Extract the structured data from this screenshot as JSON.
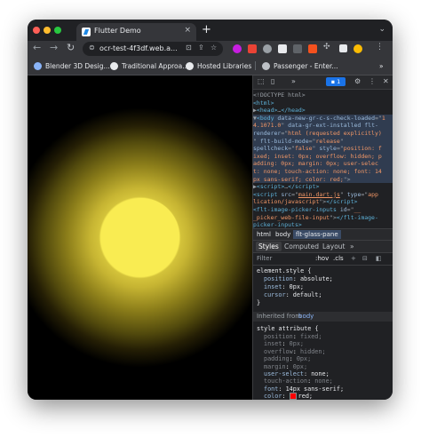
{
  "browser": {
    "tab_title": "Flutter Demo",
    "tab_close": "×",
    "new_tab": "+",
    "url": "ocr-test-4f3df.web.a...",
    "bookmarks": [
      {
        "label": "Blender 3D Desig...",
        "icon_color": "#8ab4f8"
      },
      {
        "label": "Traditional Approa...",
        "icon_color": "#e8eaed"
      },
      {
        "label": "Hosted Libraries",
        "icon_color": "#e8eaed"
      },
      {
        "label": "Passenger - Enter...",
        "icon_color": "#bdc1c6"
      }
    ],
    "bookmarks_more": "»"
  },
  "devtools": {
    "issues_count": "1",
    "elements_lines": [
      {
        "html": "<span class='punct'>&lt;!DOCTYPE html&gt;</span>"
      },
      {
        "html": "<span class='tag'>&lt;html&gt;</span>"
      },
      {
        "html": "<span class='punct'>▶</span><span class='tag'>&lt;head&gt;</span><span class='punct'>…</span><span class='tag'>&lt;/head&gt;</span>"
      },
      {
        "html": "<span class='punct'>▼</span><span class='tag'>&lt;body</span> <span class='attr'>data-new-gr-c-s-check-loaded</span><span class='punct'>=\"</span><span class='val'>1</span>",
        "sel": true
      },
      {
        "html": "<span class='val'>4.1071.0</span><span class='punct'>\"</span> <span class='attr'>data-gr-ext-installed</span> <span class='attr'>flt-</span>",
        "sel": true
      },
      {
        "html": "<span class='attr'>renderer</span><span class='punct'>=\"</span><span class='val'>html (requested explicitly)</span>",
        "sel": true
      },
      {
        "html": "<span class='punct'>\" </span><span class='attr'>flt-build-mode</span><span class='punct'>=\"</span><span class='val'>release</span><span class='punct'>\"</span>",
        "sel": true
      },
      {
        "html": "<span class='attr'>spellcheck</span><span class='punct'>=\"</span><span class='val'>false</span><span class='punct'>\" </span><span class='attr'>style</span><span class='punct'>=\"</span><span class='val'>position: f</span>",
        "sel": true
      },
      {
        "html": "<span class='val'>ixed; inset: 0px; overflow: hidden; p</span>",
        "sel": true
      },
      {
        "html": "<span class='val'>adding: 0px; margin: 0px; user-selec</span>",
        "sel": true
      },
      {
        "html": "<span class='val'>t: none; touch-action: none; font: 14</span>",
        "sel": true
      },
      {
        "html": "<span class='val'>px sans-serif; color: red;</span><span class='punct'>\"&gt;</span>",
        "sel": true
      },
      {
        "html": "<span class='punct'>  ▶</span><span class='tag'>&lt;script&gt;</span><span class='punct'>…</span><span class='tag'>&lt;/script&gt;</span>"
      },
      {
        "html": "<span class='tag'>    &lt;script</span> <span class='attr'>src</span><span class='punct'>=\"</span><span class='val' style='text-decoration:underline'>main.dart.js</span><span class='punct'>\" </span><span class='attr'>type</span><span class='punct'>=\"</span><span class='val'>app</span>"
      },
      {
        "html": "<span class='val'>    lication/javascript</span><span class='punct'>\"&gt;</span><span class='tag'>&lt;/script&gt;</span>"
      },
      {
        "html": "<span class='tag'>    &lt;flt-image-picker-inputs</span> <span class='attr'>id</span><span class='punct'>=\"</span><span class='val'>__</span>"
      },
      {
        "html": "<span class='val'>    _picker_web-file-input</span><span class='punct'>\"&gt;</span><span class='tag'>&lt;/flt-image-</span>"
      },
      {
        "html": "<span class='tag'>    picker-inputs&gt;</span>"
      }
    ],
    "crumbs": [
      "html",
      "body",
      "flt-glass-pane"
    ],
    "subtabs": [
      "Styles",
      "Computed",
      "Layout",
      "»"
    ],
    "filter_placeholder": "Filter",
    "filter_hov": ":hov",
    "filter_cls": ".cls",
    "element_style": {
      "selector": "element.style {",
      "props": [
        {
          "name": "position",
          "value": "absolute;"
        },
        {
          "name": "inset",
          "value": "0px;"
        },
        {
          "name": "cursor",
          "value": "default;"
        }
      ],
      "close": "}"
    },
    "inherited_label": "Inherited from",
    "inherited_from": "body",
    "style_attr": {
      "selector": "style attribute {",
      "props": [
        {
          "name": "position",
          "value": "fixed;",
          "dim": true
        },
        {
          "name": "inset",
          "value": "0px;",
          "dim": true
        },
        {
          "name": "overflow",
          "value": "hidden;",
          "dim": true
        },
        {
          "name": "padding",
          "value": "0px;",
          "dim": true
        },
        {
          "name": "margin",
          "value": "0px;",
          "dim": true
        },
        {
          "name": "user-select",
          "value": "none;",
          "dim": false
        },
        {
          "name": "touch-action",
          "value": "none;",
          "dim": true
        },
        {
          "name": "font",
          "value": "14px sans-serif;",
          "dim": false
        },
        {
          "name": "color",
          "value": "red;",
          "dim": false,
          "swatch": "#ff0000"
        }
      ],
      "close": "}"
    }
  }
}
